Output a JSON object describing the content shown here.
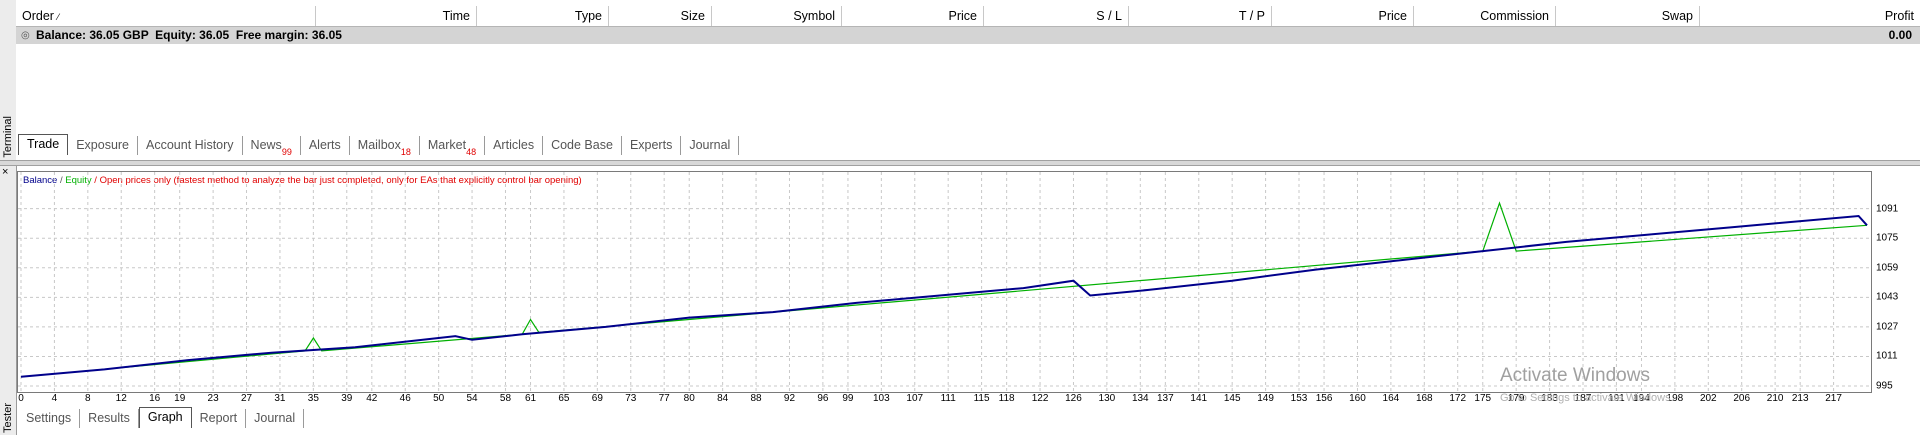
{
  "terminal": {
    "side_label": "Terminal",
    "columns": [
      "Order",
      "Time",
      "Type",
      "Size",
      "Symbol",
      "Price",
      "S / L",
      "T / P",
      "Price",
      "Commission",
      "Swap",
      "Profit"
    ],
    "balance_row": {
      "text": "Balance: 36.05 GBP  Equity: 36.05  Free margin: 36.05",
      "profit": "0.00"
    },
    "tabs": [
      {
        "label": "Trade",
        "badge": ""
      },
      {
        "label": "Exposure",
        "badge": ""
      },
      {
        "label": "Account History",
        "badge": ""
      },
      {
        "label": "News",
        "badge": "99"
      },
      {
        "label": "Alerts",
        "badge": ""
      },
      {
        "label": "Mailbox",
        "badge": "18"
      },
      {
        "label": "Market",
        "badge": "48"
      },
      {
        "label": "Articles",
        "badge": ""
      },
      {
        "label": "Code Base",
        "badge": ""
      },
      {
        "label": "Experts",
        "badge": ""
      },
      {
        "label": "Journal",
        "badge": ""
      }
    ],
    "active_tab": "Trade"
  },
  "tester": {
    "side_label": "Tester",
    "close_glyph": "×",
    "legend": {
      "balance": "Balance",
      "slash": " / ",
      "equity": "Equity",
      "note": " / Open prices only (fastest method to analyze the bar just completed, only for EAs that explicitly control bar opening)"
    },
    "tabs": [
      "Settings",
      "Results",
      "Graph",
      "Report",
      "Journal"
    ],
    "active_tab": "Graph"
  },
  "watermark": {
    "title": "Activate Windows",
    "subtitle": "Go to Settings to activate Windows."
  },
  "colors": {
    "balance": "#00008b",
    "equity": "#00b000",
    "note": "#e00000",
    "grid": "#c8c8c8"
  },
  "chart_data": {
    "type": "line",
    "x_ticks": [
      0,
      4,
      8,
      12,
      16,
      19,
      23,
      27,
      31,
      35,
      39,
      42,
      46,
      50,
      54,
      58,
      61,
      65,
      69,
      73,
      77,
      80,
      84,
      88,
      92,
      96,
      99,
      103,
      107,
      111,
      115,
      118,
      122,
      126,
      130,
      134,
      137,
      141,
      145,
      149,
      153,
      156,
      160,
      164,
      168,
      172,
      175,
      179,
      183,
      187,
      191,
      194,
      198,
      202,
      206,
      210,
      213,
      217
    ],
    "y_ticks": [
      995,
      1011,
      1027,
      1043,
      1059,
      1075,
      1091
    ],
    "ylim": [
      995,
      1100
    ],
    "xlim": [
      0,
      221
    ],
    "series": [
      {
        "name": "Balance",
        "points": [
          [
            0,
            1000
          ],
          [
            10,
            1004
          ],
          [
            20,
            1009
          ],
          [
            30,
            1013
          ],
          [
            40,
            1016
          ],
          [
            50,
            1021
          ],
          [
            52,
            1022
          ],
          [
            54,
            1020
          ],
          [
            60,
            1023
          ],
          [
            70,
            1027
          ],
          [
            80,
            1032
          ],
          [
            90,
            1035
          ],
          [
            100,
            1040
          ],
          [
            110,
            1044
          ],
          [
            120,
            1048
          ],
          [
            126,
            1052
          ],
          [
            128,
            1044
          ],
          [
            135,
            1047
          ],
          [
            145,
            1052
          ],
          [
            155,
            1058
          ],
          [
            165,
            1063
          ],
          [
            175,
            1068
          ],
          [
            185,
            1073
          ],
          [
            195,
            1077
          ],
          [
            205,
            1081
          ],
          [
            210,
            1083
          ],
          [
            220,
            1087
          ],
          [
            221,
            1082
          ]
        ]
      },
      {
        "name": "Equity",
        "points": [
          [
            0,
            1000
          ],
          [
            34,
            1014
          ],
          [
            35,
            1021
          ],
          [
            36,
            1014
          ],
          [
            60,
            1023
          ],
          [
            61,
            1031
          ],
          [
            62,
            1024
          ],
          [
            175,
            1068
          ],
          [
            177,
            1094
          ],
          [
            179,
            1068
          ],
          [
            221,
            1082
          ]
        ]
      }
    ]
  }
}
